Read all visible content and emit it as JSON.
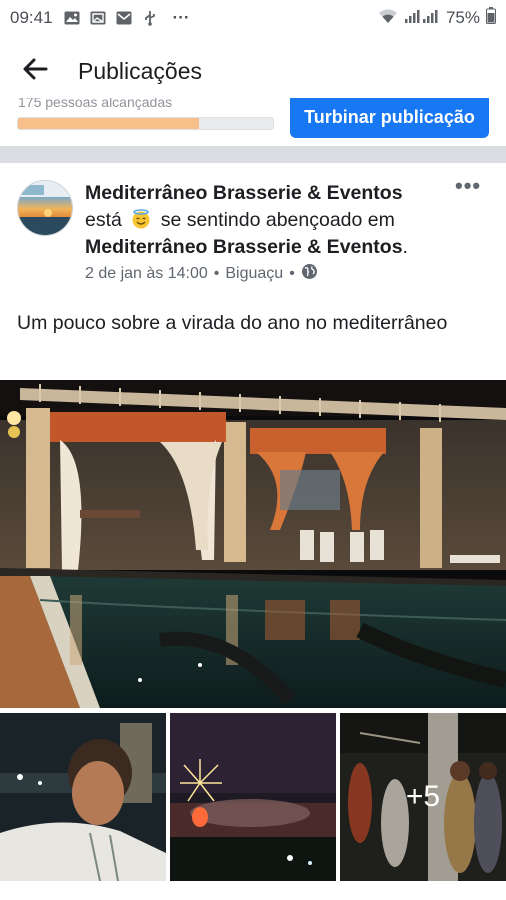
{
  "status_bar": {
    "time": "09:41",
    "icons": [
      "image-icon",
      "gallery-icon",
      "mail-icon",
      "usb-icon"
    ],
    "overflow": "···",
    "battery": "75%"
  },
  "header": {
    "title": "Publicações"
  },
  "boost": {
    "people_reached": "175 pessoas alcançadas",
    "button_label": "Turbinar publicação",
    "progress": 0.71
  },
  "post": {
    "page_name": "Mediterrâneo Brasserie & Eventos",
    "feeling_prefix": "está",
    "feeling_text": "se sentindo abençoado em",
    "location_name": "Mediterrâneo Brasserie & Eventos",
    "location_suffix": ".",
    "date": "2 de jan às 14:00",
    "separator": "•",
    "place": "Biguaçu",
    "more": "•••",
    "text": "Um pouco  sobre a virada do ano no mediterrâneo",
    "more_photos": "+5"
  },
  "colors": {
    "accent": "#1877f2",
    "progress_fill": "#f7c08a",
    "separator": "#dadde1"
  }
}
